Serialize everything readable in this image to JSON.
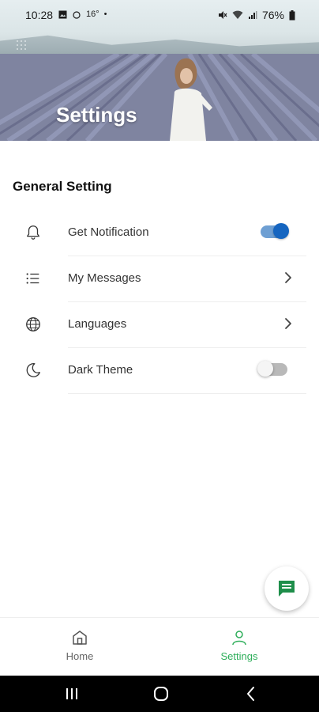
{
  "status_bar": {
    "time": "10:28",
    "temperature": "16°",
    "dot": "•",
    "battery": "76%"
  },
  "header": {
    "title": "Settings"
  },
  "section": {
    "title": "General Setting"
  },
  "settings": [
    {
      "label": "Get Notification",
      "icon": "bell-icon",
      "control": "toggle",
      "on": true
    },
    {
      "label": "My Messages",
      "icon": "list-icon",
      "control": "chevron"
    },
    {
      "label": "Languages",
      "icon": "globe-icon",
      "control": "chevron"
    },
    {
      "label": "Dark Theme",
      "icon": "moon-icon",
      "control": "toggle",
      "on": false
    }
  ],
  "fab": {
    "icon": "message-icon",
    "color": "#1e8e4a"
  },
  "bottom_nav": {
    "home_label": "Home",
    "settings_label": "Settings",
    "active": "Settings",
    "active_color": "#2eae5a"
  },
  "system_nav": [
    "recents-icon",
    "home-circle-icon",
    "back-icon"
  ]
}
